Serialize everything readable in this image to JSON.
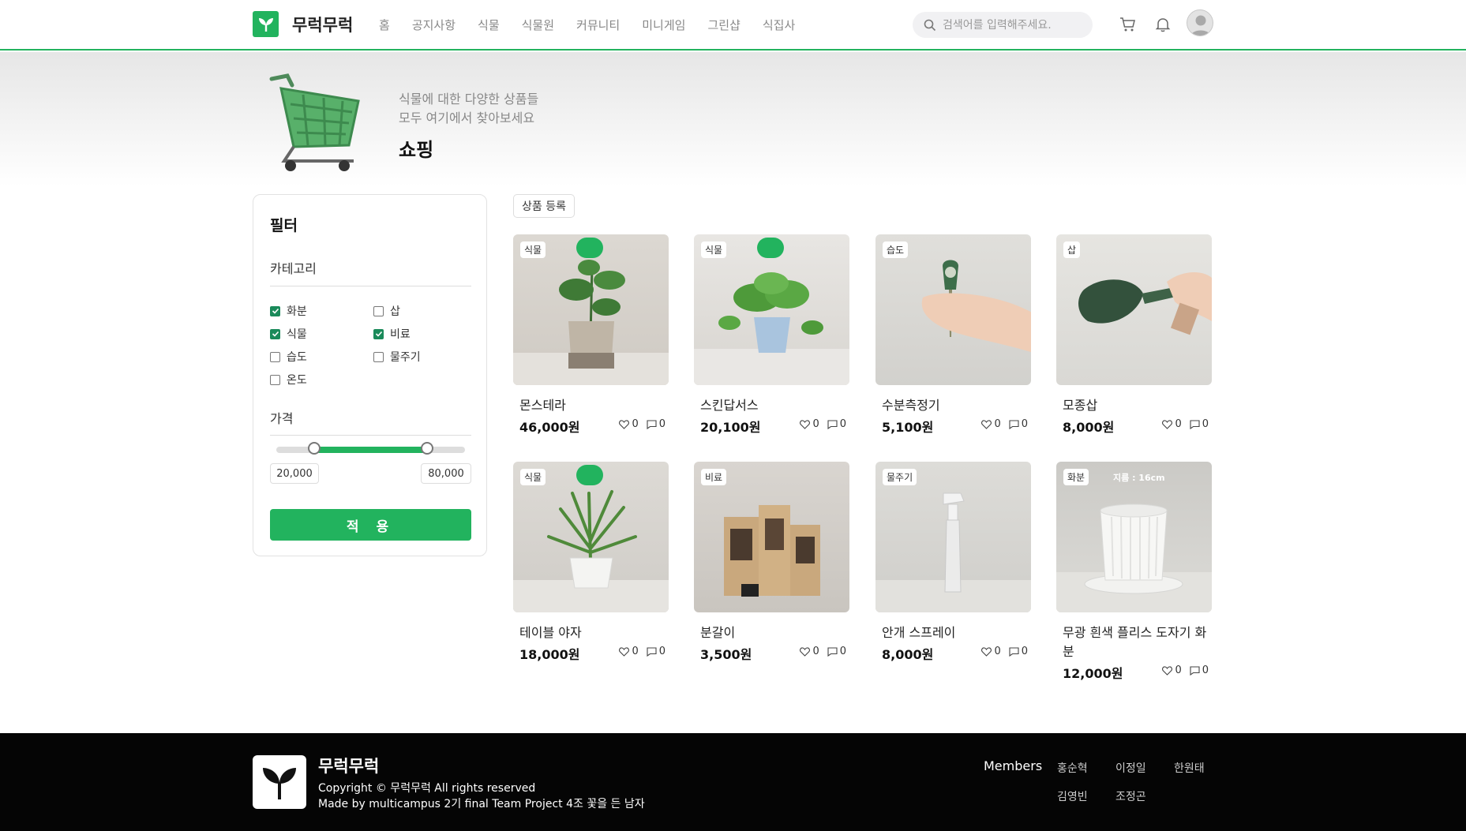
{
  "brand": {
    "name": "무럭무럭",
    "accent": "#22b35e"
  },
  "nav": [
    "홈",
    "공지사항",
    "식물",
    "식물원",
    "커뮤니티",
    "미니게임",
    "그린샵",
    "식집사"
  ],
  "search": {
    "placeholder": "검색어를 입력해주세요."
  },
  "header_icons": [
    "cart-icon",
    "bell-icon",
    "user-avatar"
  ],
  "hero": {
    "subtitle_line1": "식물에 대한 다양한 상품들",
    "subtitle_line2": "모두 여기에서 찾아보세요",
    "title": "쇼핑"
  },
  "filter": {
    "title": "필터",
    "category_title": "카테고리",
    "categories": [
      {
        "label": "화분",
        "checked": true
      },
      {
        "label": "삽",
        "checked": false
      },
      {
        "label": "식물",
        "checked": true
      },
      {
        "label": "비료",
        "checked": true
      },
      {
        "label": "습도",
        "checked": false
      },
      {
        "label": "물주기",
        "checked": false
      },
      {
        "label": "온도",
        "checked": false
      }
    ],
    "price_title": "가격",
    "price_min": "20,000",
    "price_max": "80,000",
    "range_low_fraction": 0.2,
    "range_high_fraction": 0.8,
    "apply_label": "적 용"
  },
  "register_label": "상품 등록",
  "products": [
    {
      "name": "몬스테라",
      "price": "46,000원",
      "badge": "식물",
      "likes": "0",
      "comments": "0",
      "delivery": true
    },
    {
      "name": "스킨답서스",
      "price": "20,100원",
      "badge": "식물",
      "likes": "0",
      "comments": "0",
      "delivery": true
    },
    {
      "name": "수분측정기",
      "price": "5,100원",
      "badge": "습도",
      "likes": "0",
      "comments": "0",
      "delivery": false
    },
    {
      "name": "모종삽",
      "price": "8,000원",
      "badge": "삽",
      "likes": "0",
      "comments": "0",
      "delivery": false
    },
    {
      "name": "테이블 야자",
      "price": "18,000원",
      "badge": "식물",
      "likes": "0",
      "comments": "0",
      "delivery": true
    },
    {
      "name": "분갈이",
      "price": "3,500원",
      "badge": "비료",
      "likes": "0",
      "comments": "0",
      "delivery": false
    },
    {
      "name": "안개 스프레이",
      "price": "8,000원",
      "badge": "물주기",
      "likes": "0",
      "comments": "0",
      "delivery": false
    },
    {
      "name": "무광 흰색 플리스 도자기 화분",
      "price": "12,000원",
      "badge": "화분",
      "likes": "0",
      "comments": "0",
      "delivery": false,
      "size_label": "지름 : 16cm"
    }
  ],
  "footer": {
    "title": "무럭무럭",
    "copyright": "Copyright © 무럭무럭 All rights reserved",
    "made_by": "Made by multicampus 2기 final Team Project 4조 꽃을 든 남자",
    "members_label": "Members",
    "members": [
      "홍순혁",
      "이정일",
      "한원태",
      "김영빈",
      "조정곤"
    ]
  }
}
